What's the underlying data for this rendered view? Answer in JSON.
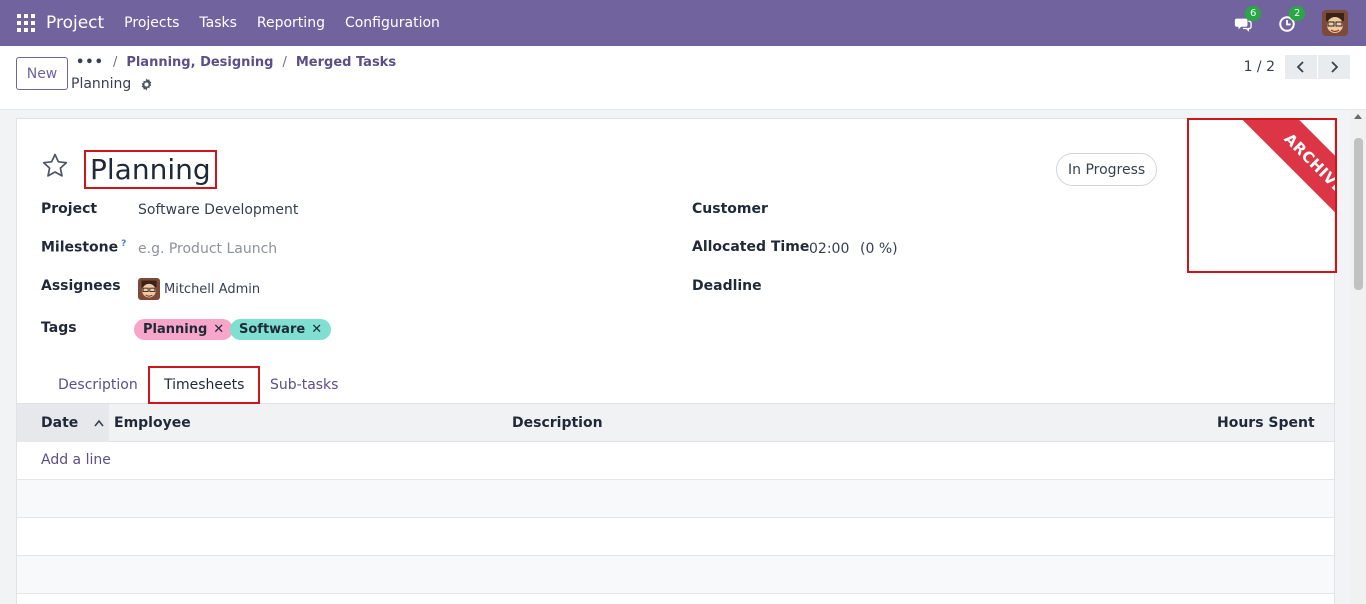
{
  "navbar": {
    "brand": "Project",
    "menu": [
      "Projects",
      "Tasks",
      "Reporting",
      "Configuration"
    ],
    "messages_count": "6",
    "activities_count": "2"
  },
  "control_panel": {
    "new_label": "New",
    "breadcrumbs": {
      "dots": "•••",
      "sep": "/",
      "items": [
        "Planning, Designing",
        "Merged Tasks"
      ]
    },
    "current_record": "Planning",
    "pager": "1 / 2"
  },
  "form": {
    "title": "Planning",
    "status": "In Progress",
    "ribbon": "ARCHIVED",
    "fields": {
      "project_label": "Project",
      "project_value": "Software Development",
      "milestone_label": "Milestone",
      "milestone_help": "?",
      "milestone_placeholder": "e.g. Product Launch",
      "assignees_label": "Assignees",
      "assignees_value": "Mitchell Admin",
      "tags_label": "Tags",
      "tags": [
        {
          "name": "Planning",
          "color": "#f7a5c9"
        },
        {
          "name": "Software",
          "color": "#7fdfd0"
        }
      ],
      "customer_label": "Customer",
      "allocated_label": "Allocated Time",
      "allocated_value": "02:00",
      "allocated_pct": "(0 %)",
      "deadline_label": "Deadline"
    },
    "tabs": [
      "Description",
      "Timesheets",
      "Sub-tasks"
    ],
    "active_tab": "Timesheets",
    "timesheet": {
      "columns": [
        "Date",
        "Employee",
        "Description",
        "Hours Spent"
      ],
      "add_line": "Add a line"
    }
  },
  "colors": {
    "navbar": "#71639e",
    "accent": "#5b4f87",
    "ribbon": "#dc3545",
    "highlight": "#d0141c"
  }
}
